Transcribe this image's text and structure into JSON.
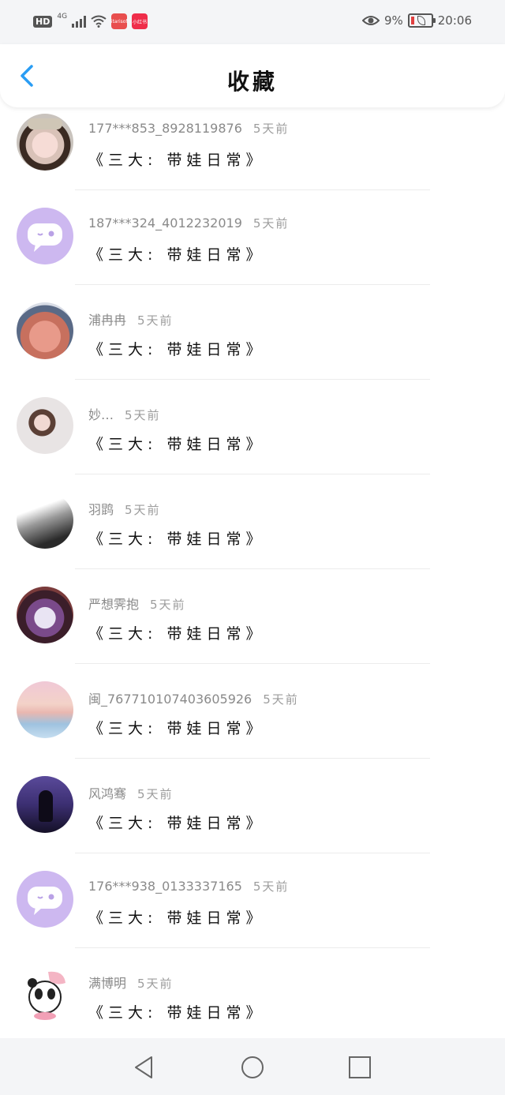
{
  "status_bar": {
    "hd": "HD",
    "network": "4G",
    "app_badges": [
      "ritarisoft",
      "小红书"
    ],
    "battery_percent": "9%",
    "time": "20:06"
  },
  "header": {
    "title": "收藏",
    "back_icon": "chevron-left-icon"
  },
  "favorites": [
    {
      "user": "177***853_8928119876",
      "time": "5天前",
      "title": "《三大: 带娃日常》",
      "avatar": "photo"
    },
    {
      "user": "187***324_4012232019",
      "time": "5天前",
      "title": "《三大: 带娃日常》",
      "avatar": "default-chat"
    },
    {
      "user": "浦冉冉",
      "time": "5天前",
      "title": "《三大: 带娃日常》",
      "avatar": "food-photo"
    },
    {
      "user": "妙…",
      "time": "5天前",
      "title": "《三大: 带娃日常》",
      "avatar": "portrait"
    },
    {
      "user": "羽鹍",
      "time": "5天前",
      "title": "《三大: 带娃日常》",
      "avatar": "bw-photo"
    },
    {
      "user": "严想霁抱",
      "time": "5天前",
      "title": "《三大: 带娃日常》",
      "avatar": "jacket-photo"
    },
    {
      "user": "闽_7677101074036059​26",
      "time": "5天前",
      "title": "《三大: 带娃日常》",
      "avatar": "sunset-photo"
    },
    {
      "user": "风鸿骞",
      "time": "5天前",
      "title": "《三大: 带娃日常》",
      "avatar": "night-photo"
    },
    {
      "user": "176***938_0133337165",
      "time": "5天前",
      "title": "《三大: 带娃日常》",
      "avatar": "default-chat"
    },
    {
      "user": "满博明",
      "time": "5天前",
      "title": "《三大: 带娃日常》",
      "avatar": "panda-sticker"
    }
  ],
  "nav_bar": {
    "icons": [
      "back-triangle-icon",
      "home-circle-icon",
      "recents-square-icon"
    ]
  },
  "colors": {
    "accent": "#2a9df4",
    "default_avatar": "#cdb8f0",
    "meta_text": "#8a8a8a"
  }
}
